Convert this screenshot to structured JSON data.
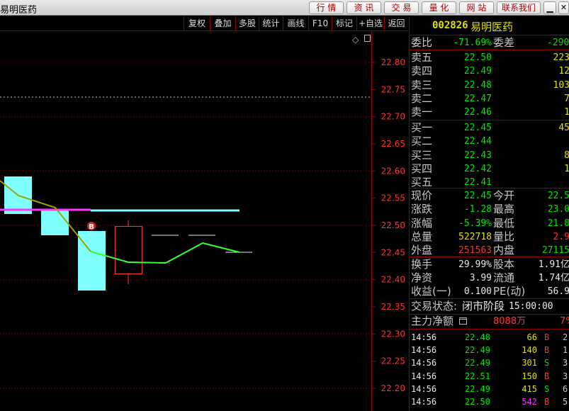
{
  "title": "易明医药",
  "top_buttons": [
    "行 情",
    "资 讯",
    "交 易",
    "量 化",
    "网 站",
    "联系我们"
  ],
  "toolbar": [
    "复权",
    "叠加",
    "多股",
    "统计",
    "画线",
    "F10",
    "标记",
    "+自选",
    "返回"
  ],
  "diamond": "◇",
  "axis_labels": [
    "22.80",
    "22.75",
    "22.70",
    "22.65",
    "22.60",
    "22.55",
    "22.50",
    "22.45",
    "22.40",
    "22.35",
    "22.30",
    "22.25",
    "22.20"
  ],
  "marker": "B",
  "stock": {
    "code": "002826",
    "name": "易明医药"
  },
  "weibi": {
    "label": "委比",
    "value": "-71.69%",
    "label2": "委差",
    "value2": "-290"
  },
  "asks": [
    {
      "label": "卖五",
      "price": "22.50",
      "vol": "223"
    },
    {
      "label": "卖四",
      "price": "22.49",
      "vol": "12"
    },
    {
      "label": "卖三",
      "price": "22.48",
      "vol": "103"
    },
    {
      "label": "卖二",
      "price": "22.47",
      "vol": "7"
    },
    {
      "label": "卖一",
      "price": "22.46",
      "vol": "1"
    }
  ],
  "bids": [
    {
      "label": "买一",
      "price": "22.45",
      "vol": "45"
    },
    {
      "label": "买二",
      "price": "22.44",
      "vol": ""
    },
    {
      "label": "买三",
      "price": "22.43",
      "vol": "8"
    },
    {
      "label": "买四",
      "price": "22.42",
      "vol": "1"
    },
    {
      "label": "买五",
      "price": "22.41",
      "vol": ""
    }
  ],
  "quote": [
    {
      "l1": "现价",
      "v1": "22.45",
      "c1": "green",
      "l2": "今开",
      "v2": "22.5",
      "c2": "green"
    },
    {
      "l1": "涨跌",
      "v1": "-1.28",
      "c1": "green",
      "l2": "最高",
      "v2": "23.0",
      "c2": "green"
    },
    {
      "l1": "涨幅",
      "v1": "-5.39%",
      "c1": "green",
      "l2": "最低",
      "v2": "21.8",
      "c2": "green"
    },
    {
      "l1": "总量",
      "v1": "522718",
      "c1": "yellow",
      "l2": "量比",
      "v2": "2.9",
      "c2": "red"
    },
    {
      "l1": "外盘",
      "v1": "251563",
      "c1": "red",
      "l2": "内盘",
      "v2": "27115",
      "c2": "green"
    }
  ],
  "stats": [
    {
      "l1": "换手",
      "v1": "29.99%",
      "l2": "股本",
      "v2": "1.91亿"
    },
    {
      "l1": "净资",
      "v1": "3.99",
      "l2": "流通",
      "v2": "1.74亿"
    },
    {
      "l1": "收益(一)",
      "v1": "0.100",
      "l2": "PE(动)",
      "v2": "56.9"
    }
  ],
  "status": {
    "label": "交易状态:",
    "value": "闭市阶段",
    "time": "15:00:00"
  },
  "main_flow": {
    "label": "主力净额",
    "value": "8088万",
    "pct": "7%"
  },
  "ticks": [
    {
      "time": "14:56",
      "price": "22.48",
      "vol": "66",
      "bs": "B",
      "n": "2"
    },
    {
      "time": "14:56",
      "price": "22.49",
      "vol": "140",
      "bs": "B",
      "n": "1"
    },
    {
      "time": "14:56",
      "price": "22.49",
      "vol": "301",
      "bs": "S",
      "n": "3"
    },
    {
      "time": "14:56",
      "price": "22.51",
      "vol": "150",
      "bs": "B",
      "n": "3"
    },
    {
      "time": "14:56",
      "price": "22.49",
      "vol": "415",
      "bs": "S",
      "n": "6"
    },
    {
      "time": "14:56",
      "price": "22.50",
      "vol": "542",
      "bs": "B",
      "n": "5"
    }
  ]
}
